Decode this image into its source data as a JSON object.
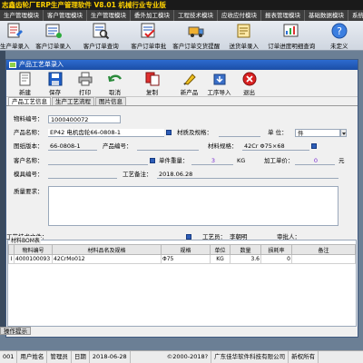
{
  "app": {
    "title": "志鑫齿轮厂ERP生产管理软件  V8.01  机械行业专业版"
  },
  "modules": [
    "生产管理模块",
    "客户管理模块",
    "生产管理模块",
    "委外加工模块",
    "工程技术模块",
    "应收应付模块",
    "报表管理模块",
    "基础数据模块",
    "系统功能模块"
  ],
  "app_toolbar": [
    {
      "label": "生产单录入",
      "icon": "doc-edit-icon"
    },
    {
      "label": "客户订单录入",
      "icon": "order-entry-icon"
    },
    {
      "label": "客户订单查询",
      "icon": "order-query-icon"
    },
    {
      "label": "客户订单审批",
      "icon": "order-approve-icon"
    },
    {
      "label": "客户订单交货提醒",
      "icon": "delivery-remind-icon"
    },
    {
      "label": "送货单录入",
      "icon": "delivery-entry-icon"
    },
    {
      "label": "订单进度明细查询",
      "icon": "progress-query-icon"
    },
    {
      "label": "未定义",
      "icon": "undefined-icon"
    }
  ],
  "window": {
    "title": "产品工艺单录入"
  },
  "window_toolbar": [
    {
      "key": "new",
      "label": "新建",
      "icon": "new-icon"
    },
    {
      "key": "save",
      "label": "保存",
      "icon": "save-icon"
    },
    {
      "key": "print",
      "label": "打印",
      "icon": "print-icon"
    },
    {
      "key": "cancel",
      "label": "取消",
      "icon": "cancel-icon"
    },
    {
      "key": "copy",
      "label": "复制",
      "icon": "copy-icon"
    },
    {
      "key": "new_product",
      "label": "新产品",
      "icon": "new-product-icon"
    },
    {
      "key": "guide",
      "label": "工序导入",
      "icon": "import-icon"
    },
    {
      "key": "exit",
      "label": "退出",
      "icon": "exit-icon"
    }
  ],
  "tabs": [
    "产品工艺信息",
    "生产工艺流程",
    "图片信息"
  ],
  "form": {
    "material_code_label": "物料编号：",
    "material_code": "1000400072",
    "product_name_label": "产品名称：",
    "product_name": "EP42 电机齿轮66-0808-1",
    "material_spec_label": "材质及规格：",
    "material_spec": "",
    "unit_label": "单 位：",
    "unit": "件",
    "drawing_no_label": "图纸版本：",
    "drawing_no": "66-0808-1",
    "product_code_label": "产品编号：",
    "product_code": "",
    "material_spec2_label": "材料规格：",
    "material_spec2": "42Cr  Φ75×68",
    "customer_name_label": "客户名称：",
    "customer_name": "",
    "unit_weight_label": "单件重量：",
    "unit_weight": "3",
    "weight_unit": "KG",
    "unit_price_label": "加工单价：",
    "unit_price": "0",
    "price_unit": "元",
    "mold_code_label": "模具编号：",
    "mold_code": "",
    "process_note_label": "工艺备注：",
    "process_note": "2018.06.28",
    "quality_label": "质量要求：",
    "quality": "",
    "tech_file_label": "工艺技术文件：",
    "tech_file": "",
    "craftsman_label": "工艺员：",
    "craftsman": "李朝明",
    "reviewer_label": "审批人：",
    "reviewer": ""
  },
  "grid": {
    "caption": "材料BOM表",
    "columns": [
      "物料编号",
      "材料品名及规格",
      "规格",
      "单位",
      "数量",
      "损耗率",
      "备注"
    ],
    "rows": [
      {
        "indicator": "I",
        "code": "4000100093",
        "name": "42CrMo012",
        "spec": "Φ75",
        "unit": "KG",
        "qty": "3.6",
        "loss": "0",
        "note": ""
      }
    ]
  },
  "hint_tab": "操作提示",
  "status": {
    "items": [
      "001",
      "用户姓名",
      "管理员",
      "日期",
      "2018-06-28",
      "©2000-2018?",
      "广东佳华软件科技有限公司",
      "新权所有"
    ]
  }
}
